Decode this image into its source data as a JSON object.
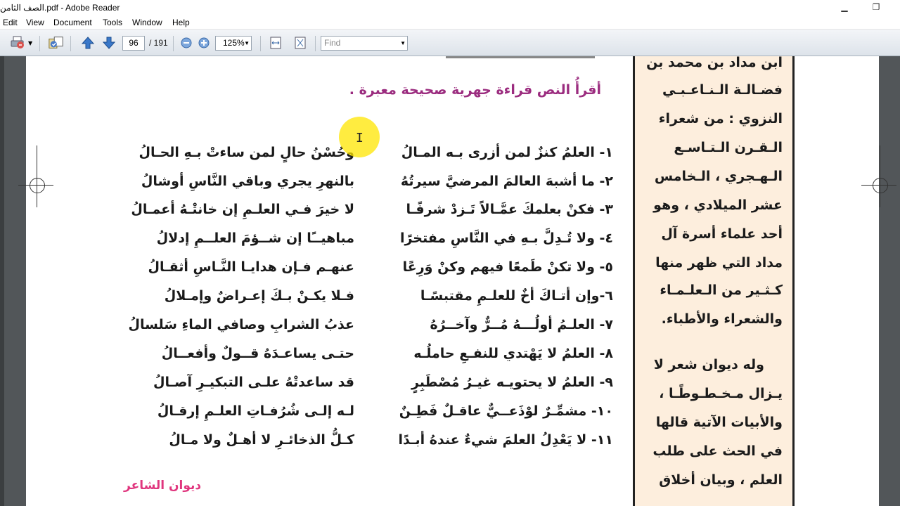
{
  "window": {
    "title": "الصف الثامن.pdf - Adobe Reader",
    "minimize_glyph": "▁",
    "restore_glyph": "❐"
  },
  "menu": [
    "Edit",
    "View",
    "Document",
    "Tools",
    "Window",
    "Help"
  ],
  "toolbar": {
    "page_current": "96",
    "page_total": "/ 191",
    "zoom": "125%",
    "find_placeholder": "Find"
  },
  "content": {
    "heading": "أقرأُ النص قراءة جهرية صحيحة معبرة .",
    "verses": [
      {
        "first": "١- العلمُ كنزٌ لمن أزرى بـه المـالُ",
        "second": "وحُسْنُ حالٍ لمن ساءتْ بـهِ الحـالُ"
      },
      {
        "first": "٢- ما أشبهَ العالمَ المرضيَّ سيرتُهُ",
        "second": "بالنهرِ يجري وباقي النَّاسِ أوشالُ"
      },
      {
        "first": "٣- فكنْ بعلمكَ عمَّـالاً تَـزدْ شرفًـا",
        "second": "لا خيرَ فـي العلـمِ إن خانتْـهُ أعمـالُ"
      },
      {
        "first": "٤- ولا تُـدِلَّ بـهِ في النَّاسِ مفتخرًا",
        "second": "مباهيــًا إن شــؤمَ العلــمِ إدلالُ"
      },
      {
        "first": "٥- ولا تكنْ طَمعًا فيهم وكنْ وَرِعًا",
        "second": "عنهـم فـإن هدايـا النَّـاسِ أثقـالُ"
      },
      {
        "first": "٦-وإن أتـاكَ أخٌ للعلـمِ مقتبسًـا",
        "second": "فـلا يكـنْ بـكَ إعـراضٌ وإمـلالُ"
      },
      {
        "first": "٧- العلـمُ أولُـــهُ مُــرٌّ وآخــرُهُ",
        "second": "عذبُ الشرابِ وصافي الماءِ سَلسالُ"
      },
      {
        "first": "٨- العلمُ لا يَهْتدي للنفـعِ حاملُـه",
        "second": "حتـى يساعـدَهُ قــولٌ وأفعــالُ"
      },
      {
        "first": "٩- العلمُ لا يحتويـه غيـرُ مُصْطَبِرٍ",
        "second": "قد ساعدتْهُ علـى التبكيـرِ آصـالُ"
      },
      {
        "first": "١٠- مشمِّـرٌ لوْذَعــيٌّ عاقـلٌ فَطِـنٌ",
        "second": "لـه إلـى شُرُفـاتِ العلـمِ إرقـالُ"
      },
      {
        "first": "١١- لا يَعْدِلُ العلمَ شيءٌ عندهُ أبـدًا",
        "second": "كـلُّ الذخائـرِ لا أهـلٌ ولا مـالُ"
      }
    ],
    "source": "ديوان الشاعر"
  },
  "sidebar": {
    "lines": [
      "ابن مداد بن محمد بن",
      "فضـالـة الـنـاعـبـي",
      "النزوي : من شعراء",
      "الـقـرن الـتـاسـع",
      "الـهـجري ، الـخامس",
      "عشر الميلادي ، وهو",
      "أحد علماء أسرة آل",
      "مداد التي ظهر منها",
      "كـثـير من الـعلـمـاء",
      "والشعراء والأطباء.",
      "وله ديوان شعر لا",
      "يـزال مـخـطـوطًـا ،",
      "والأبيات الآتية قالها",
      "في الحث على طلب",
      "العلم ، وبيان أخلاق"
    ]
  },
  "colors": {
    "heading": "#9b2c7f",
    "source": "#e0367e",
    "sidebar_bg": "#fdeedd"
  }
}
